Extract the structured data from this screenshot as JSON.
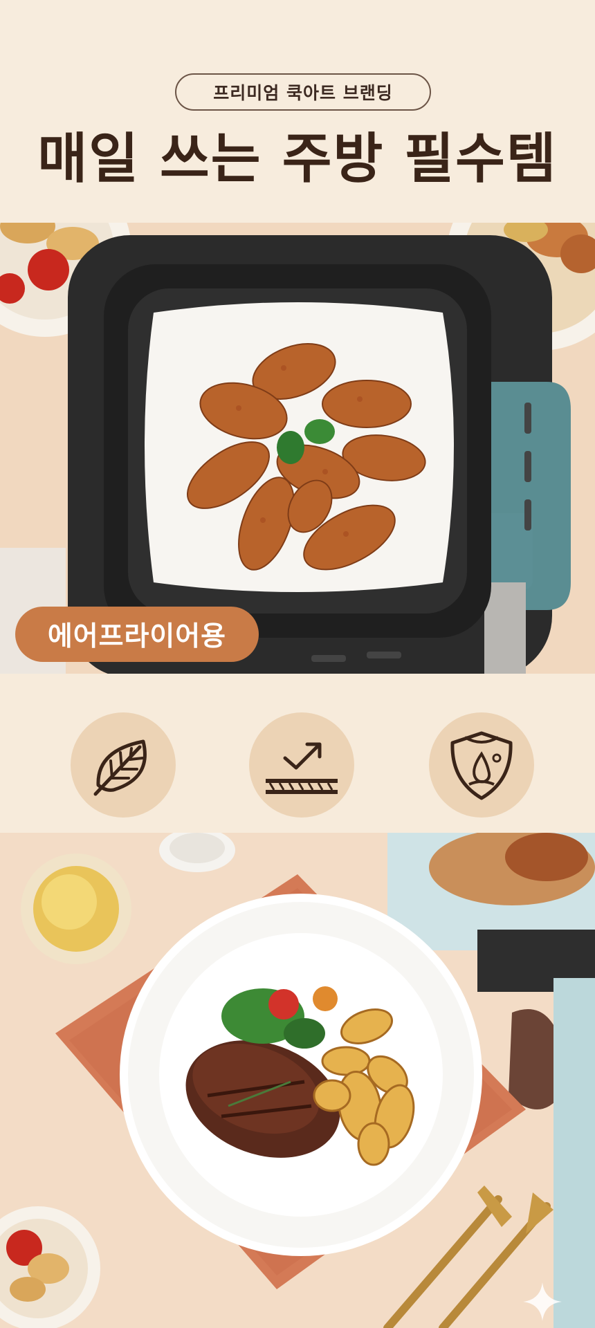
{
  "header": {
    "brand_pill": "프리미엄 쿡아트 브랜딩",
    "title": "매일 쓰는 주방 필수템"
  },
  "hero": {
    "badge": "에어프라이어용"
  },
  "features": {
    "icons": [
      "leaf-icon",
      "trend-up-layers-icon",
      "shield-drop-icon"
    ]
  },
  "colors": {
    "header_bg": "#f7ecdd",
    "title_text": "#3a2418",
    "badge_bg": "#c97b47",
    "icon_circle": "#ecd3b5",
    "icon_stroke": "#3a2418"
  }
}
